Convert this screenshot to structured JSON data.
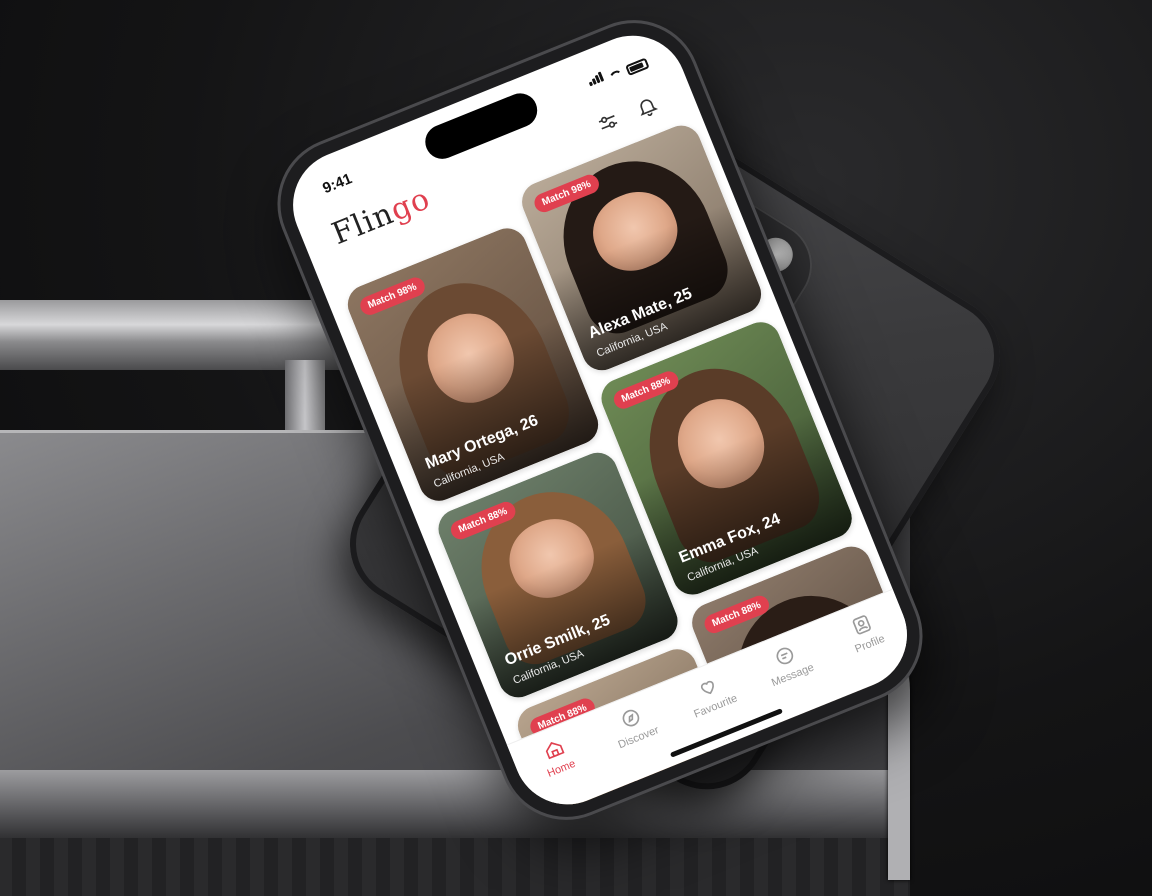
{
  "status": {
    "time": "9:41"
  },
  "app": {
    "logo_main": "Flin",
    "logo_accent": "go"
  },
  "profiles": [
    {
      "match": "Match 98%",
      "name": "Mary Ortega, 26",
      "location": "California, USA"
    },
    {
      "match": "Match 98%",
      "name": "Alexa Mate, 25",
      "location": "California, USA"
    },
    {
      "match": "Match 88%",
      "name": "Orrie Smilk, 25",
      "location": "California, USA"
    },
    {
      "match": "Match 88%",
      "name": "Emma Fox, 24",
      "location": "California, USA"
    },
    {
      "match": "Match 88%",
      "name": "",
      "location": ""
    },
    {
      "match": "Match 88%",
      "name": "",
      "location": ""
    }
  ],
  "nav": [
    {
      "label": "Home",
      "icon": "home-icon"
    },
    {
      "label": "Discover",
      "icon": "compass-icon"
    },
    {
      "label": "Favourite",
      "icon": "heart-icon"
    },
    {
      "label": "Message",
      "icon": "message-icon"
    },
    {
      "label": "Profile",
      "icon": "profile-icon"
    }
  ],
  "colors": {
    "accent": "#e0404f"
  }
}
